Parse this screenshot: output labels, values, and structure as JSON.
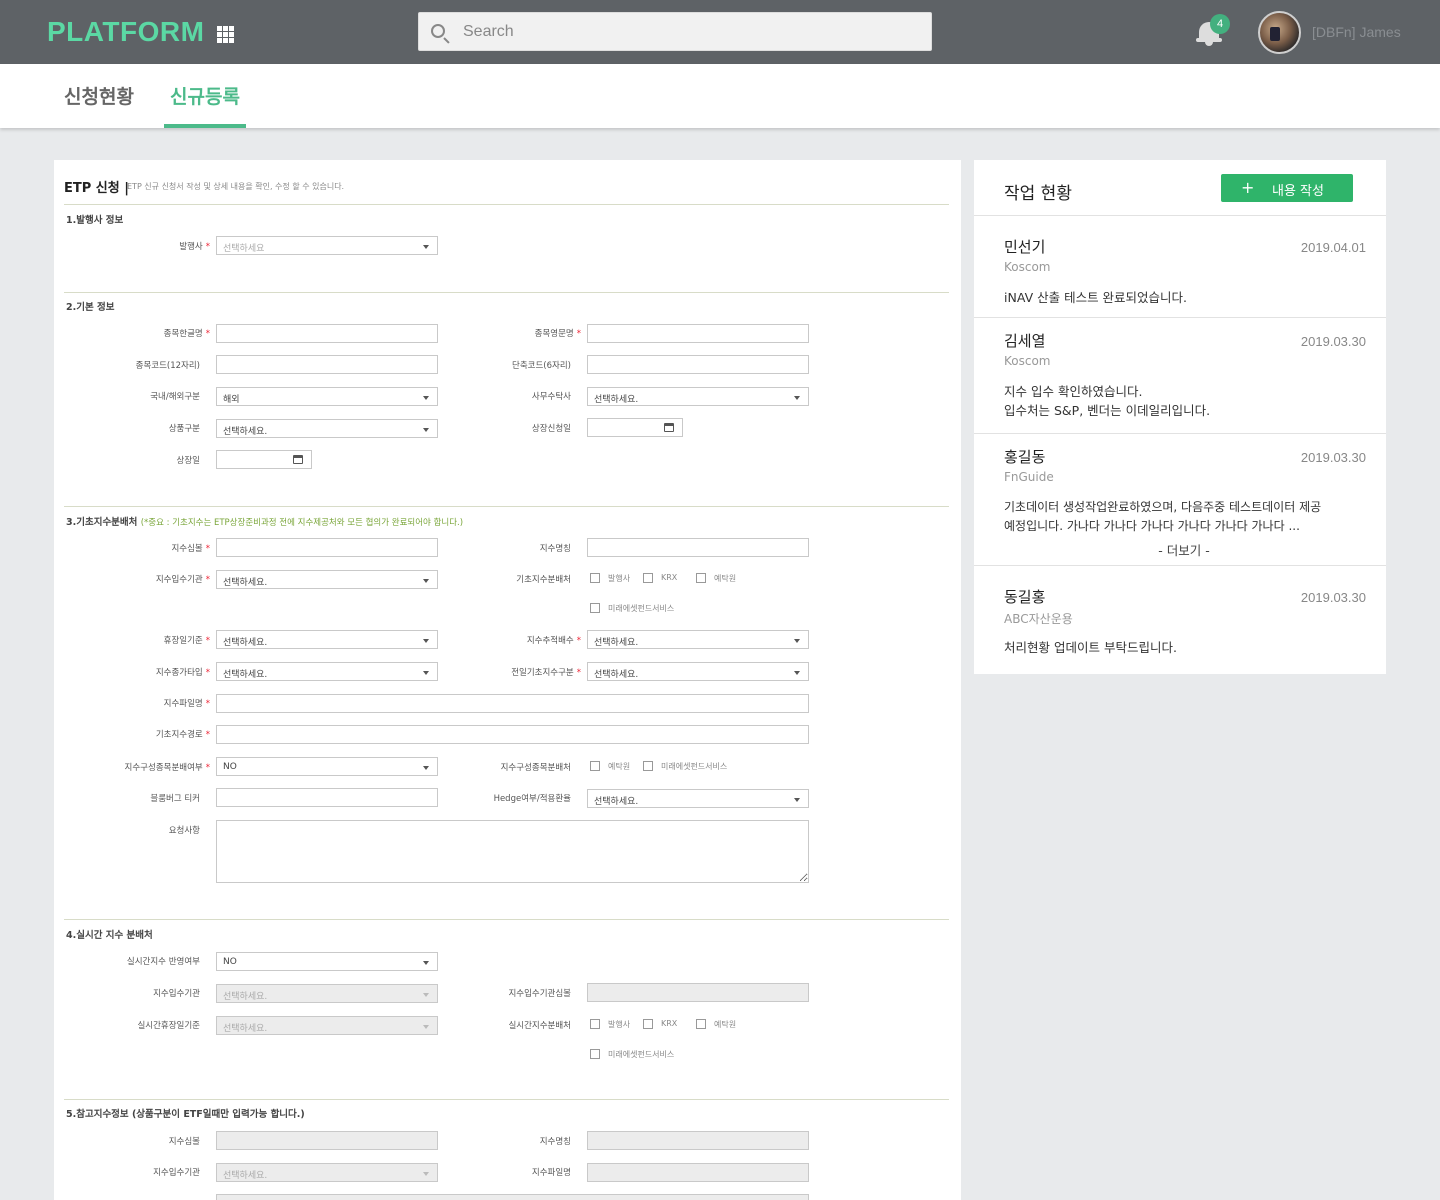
{
  "header": {
    "logo": "PLATFORM",
    "search_placeholder": "Search",
    "notification_count": "4",
    "username": "[DBFn] James"
  },
  "tabs": [
    "신청현황",
    "신규등록"
  ],
  "form": {
    "title": "ETP 신청 |",
    "subtitle": "ETP 신규 신청서 작성 및 상세 내용을 확인, 수정 할 수 있습니다.",
    "select_placeholder": "선택하세요",
    "select_default": "선택하세요.",
    "s1": {
      "title": "1.발행사 정보",
      "issuer": "발행사"
    },
    "s2": {
      "title": "2.기본 정보",
      "kor_name": "종목한글명",
      "eng_name": "종목영문명",
      "code12": "종목코드(12자리)",
      "code6": "단축코드(6자리)",
      "domestic": "국내/해외구분",
      "domestic_value": "해외",
      "trustee": "사무수탁사",
      "product_type": "상품구분",
      "listing_apply": "상장신청일",
      "listing_date": "상장일"
    },
    "s3": {
      "title": "3.기초지수분배처",
      "note": "(*중요 : 기초지수는 ETP상장준비과정 전에 지수제공처와 모든 협의가 완료되어야 합니다.)",
      "symbol": "지수심볼",
      "index_name": "지수명칭",
      "provider": "지수입수기관",
      "distributor": "기초지수분배처",
      "cb_issuer": "발행사",
      "cb_krx": "KRX",
      "cb_ksd": "예탁원",
      "cb_mirae": "미래에셋펀드서비스",
      "holiday": "휴장일기준",
      "tracking": "지수추적배수",
      "price_type": "지수종가타입",
      "prev_day": "전일기초지수구분",
      "file_name": "지수파일명",
      "path": "기초지수경로",
      "component_dist": "지수구성종목분배여부",
      "component_dist_value": "NO",
      "component_distributor": "지수구성종목분배처",
      "bloomberg": "블룸버그 티커",
      "hedge": "Hedge여부/적용환율",
      "request": "요청사항"
    },
    "s4": {
      "title": "4.실시간 지수 분배처",
      "reflect": "실시간지수 반영여부",
      "reflect_value": "NO",
      "provider": "지수입수기관",
      "provider_symbol": "지수입수기관심볼",
      "holiday": "실시간휴장일기준",
      "distributor": "실시간지수분배처"
    },
    "s5": {
      "title": "5.참고지수정보 (상품구분이 ETF일때만 입력가능 합니다.)",
      "symbol": "지수심볼",
      "index_name": "지수명칭",
      "provider": "지수입수기관",
      "file_name": "지수파일명"
    }
  },
  "activity": {
    "title": "작업 현황",
    "add_button": "내용 작성",
    "items": [
      {
        "name": "민선기",
        "org": "Koscom",
        "date": "2019.04.01",
        "lines": [
          "iNAV 산출 테스트 완료되었습니다."
        ]
      },
      {
        "name": "김세열",
        "org": "Koscom",
        "date": "2019.03.30",
        "lines": [
          "지수 입수 확인하였습니다.",
          "입수처는 S&P, 벤더는 이데일리입니다."
        ]
      },
      {
        "name": "홍길동",
        "org": "FnGuide",
        "date": "2019.03.30",
        "lines": [
          "기초데이터 생성작업완료하였으며, 다음주중 테스트데이터 제공",
          "예정입니다. 가나다 가나다 가나다 가나다 가나다 가나다 ..."
        ],
        "more": "- 더보기 -"
      },
      {
        "name": "동길홍",
        "org": "ABC자산운용",
        "date": "2019.03.30",
        "lines": [
          "처리현황 업데이트 부탁드립니다."
        ]
      }
    ]
  }
}
